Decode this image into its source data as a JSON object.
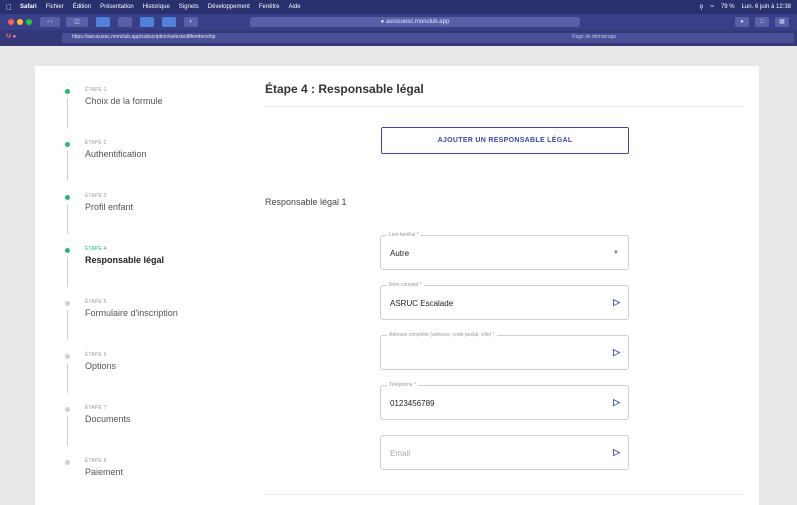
{
  "menubar": {
    "items": [
      "Safari",
      "Fichier",
      "Édition",
      "Présentation",
      "Historique",
      "Signets",
      "Développement",
      "Fenêtre",
      "Aide"
    ],
    "status": "79 %",
    "clock": "Lun. 6 juin à 12:38"
  },
  "browser": {
    "url": "asrucuesc.monclub.app",
    "tab_url": "https://asrucuesc.monclub.app/subscription/selectedMembership",
    "tab_hint": "Page de démarrage"
  },
  "stepper": {
    "steps": [
      {
        "num": "ÉTAPE 1",
        "label": "Choix de la formule",
        "state": "done"
      },
      {
        "num": "ÉTAPE 2",
        "label": "Authentification",
        "state": "done"
      },
      {
        "num": "ÉTAPE 3",
        "label": "Profil enfant",
        "state": "done"
      },
      {
        "num": "ÉTAPE 4",
        "label": "Responsable légal",
        "state": "active"
      },
      {
        "num": "ÉTAPE 5",
        "label": "Formulaire d'inscription",
        "state": "todo"
      },
      {
        "num": "ÉTAPE 6",
        "label": "Options",
        "state": "todo"
      },
      {
        "num": "ÉTAPE 7",
        "label": "Documents",
        "state": "todo"
      },
      {
        "num": "ÉTAPE 8",
        "label": "Paiement",
        "state": "todo"
      }
    ]
  },
  "main": {
    "title": "Étape 4 : Responsable légal",
    "add_button": "AJOUTER UN RESPONSABLE LÉGAL",
    "section_title": "Responsable légal 1",
    "fields": {
      "lien": {
        "label": "Lien familial *",
        "value": "Autre"
      },
      "nom": {
        "label": "Nom complet *",
        "value": "ASRUC Escalade"
      },
      "adresse": {
        "label": "Adresse complète (adresse, code postal, ville) *",
        "value": ""
      },
      "telephone": {
        "label": "Téléphone *",
        "value": "0123456789"
      },
      "email": {
        "label": "",
        "placeholder": "Email"
      }
    }
  }
}
